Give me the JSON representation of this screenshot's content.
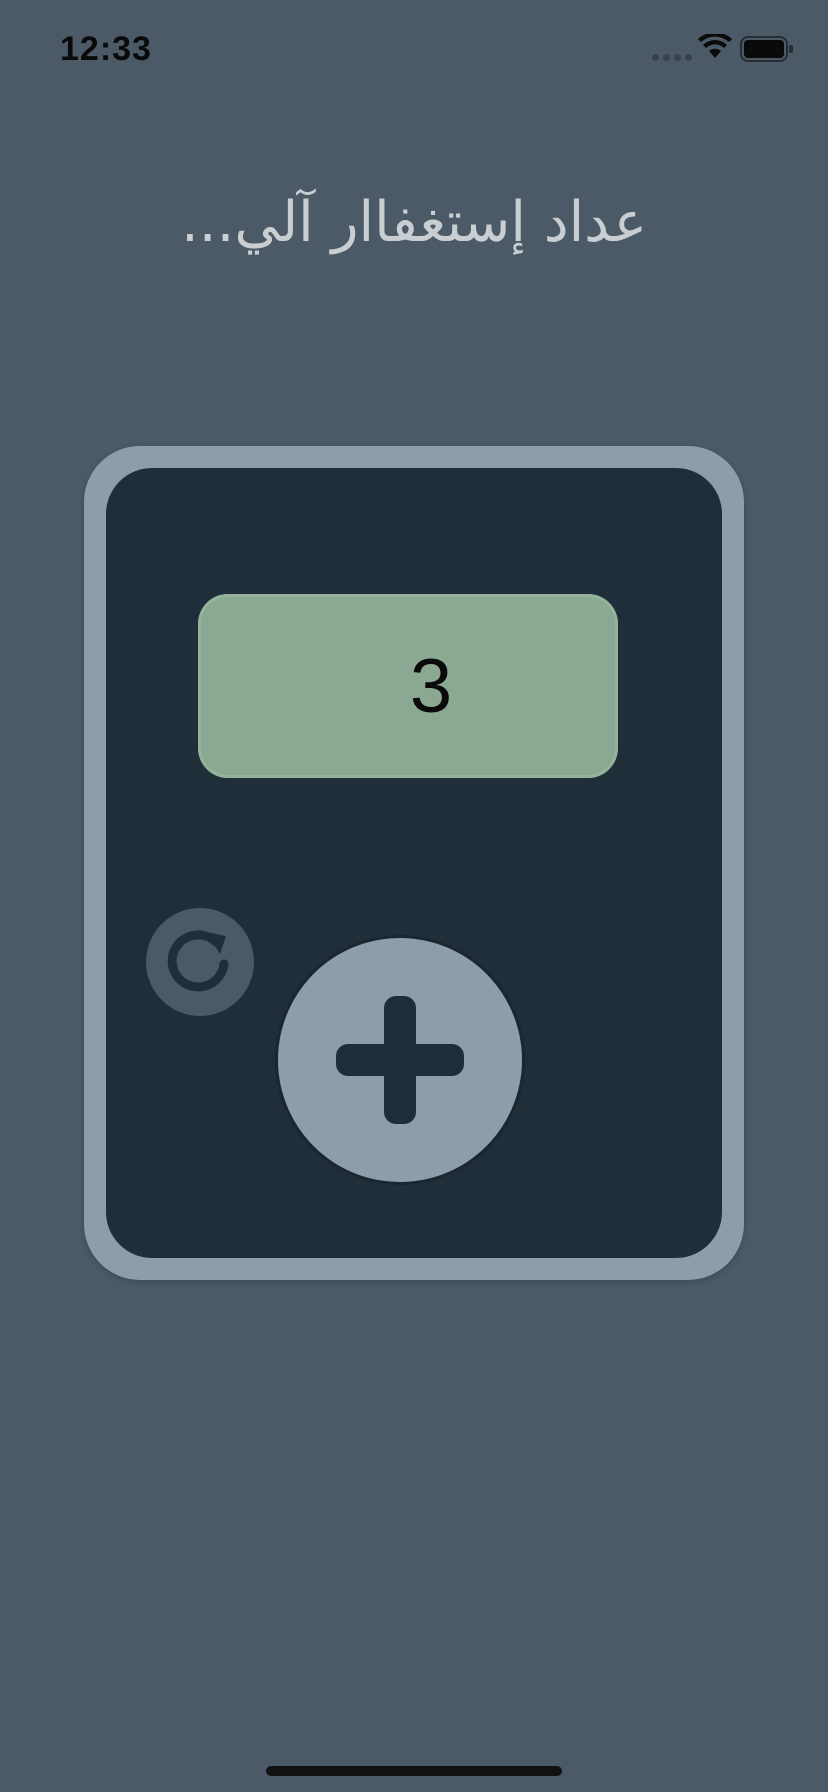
{
  "status_bar": {
    "time": "12:33",
    "icons": [
      "signal-dots-icon",
      "wifi-icon",
      "battery-icon"
    ]
  },
  "header": {
    "title": "عداد إستغفاار آلي..."
  },
  "counter": {
    "value": "3",
    "reset_icon": "reset-rotate-icon",
    "add_icon": "plus-icon"
  },
  "colors": {
    "background": "#4b5a66",
    "device_frame": "#8d9dac",
    "device_body": "#202e39",
    "display": "#8ba892",
    "title_text": "#c9ced3"
  }
}
